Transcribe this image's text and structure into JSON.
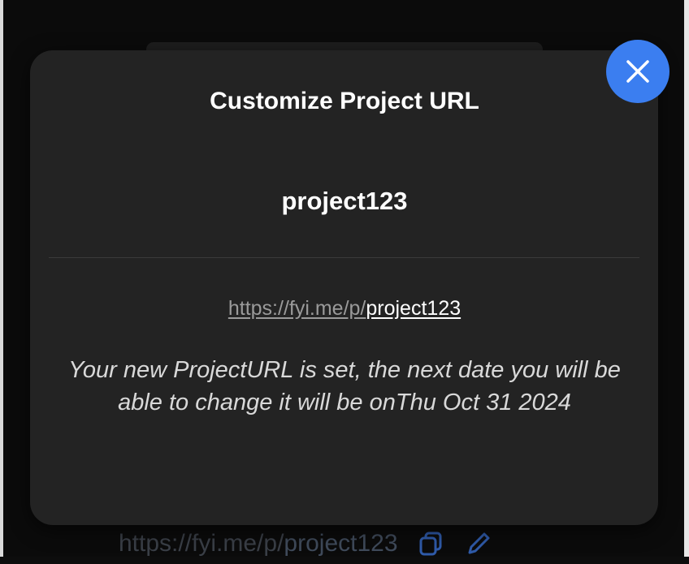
{
  "modal": {
    "title": "Customize Project URL",
    "project_name": "project123",
    "url_prefix": "https://fyi.me/p/",
    "url_slug": "project123",
    "message": "Your new ProjectURL is set, the next date you will be able to change it will be onThu Oct 31 2024",
    "close_icon": "close-icon"
  },
  "background": {
    "url_prefix": "https://fyi.me/p/",
    "url_slug": "project123",
    "icons": [
      "copy-icon",
      "edit-icon"
    ]
  },
  "colors": {
    "accent": "#3b7ef0",
    "modal_bg": "#232323",
    "page_bg": "#0b0b0b"
  }
}
